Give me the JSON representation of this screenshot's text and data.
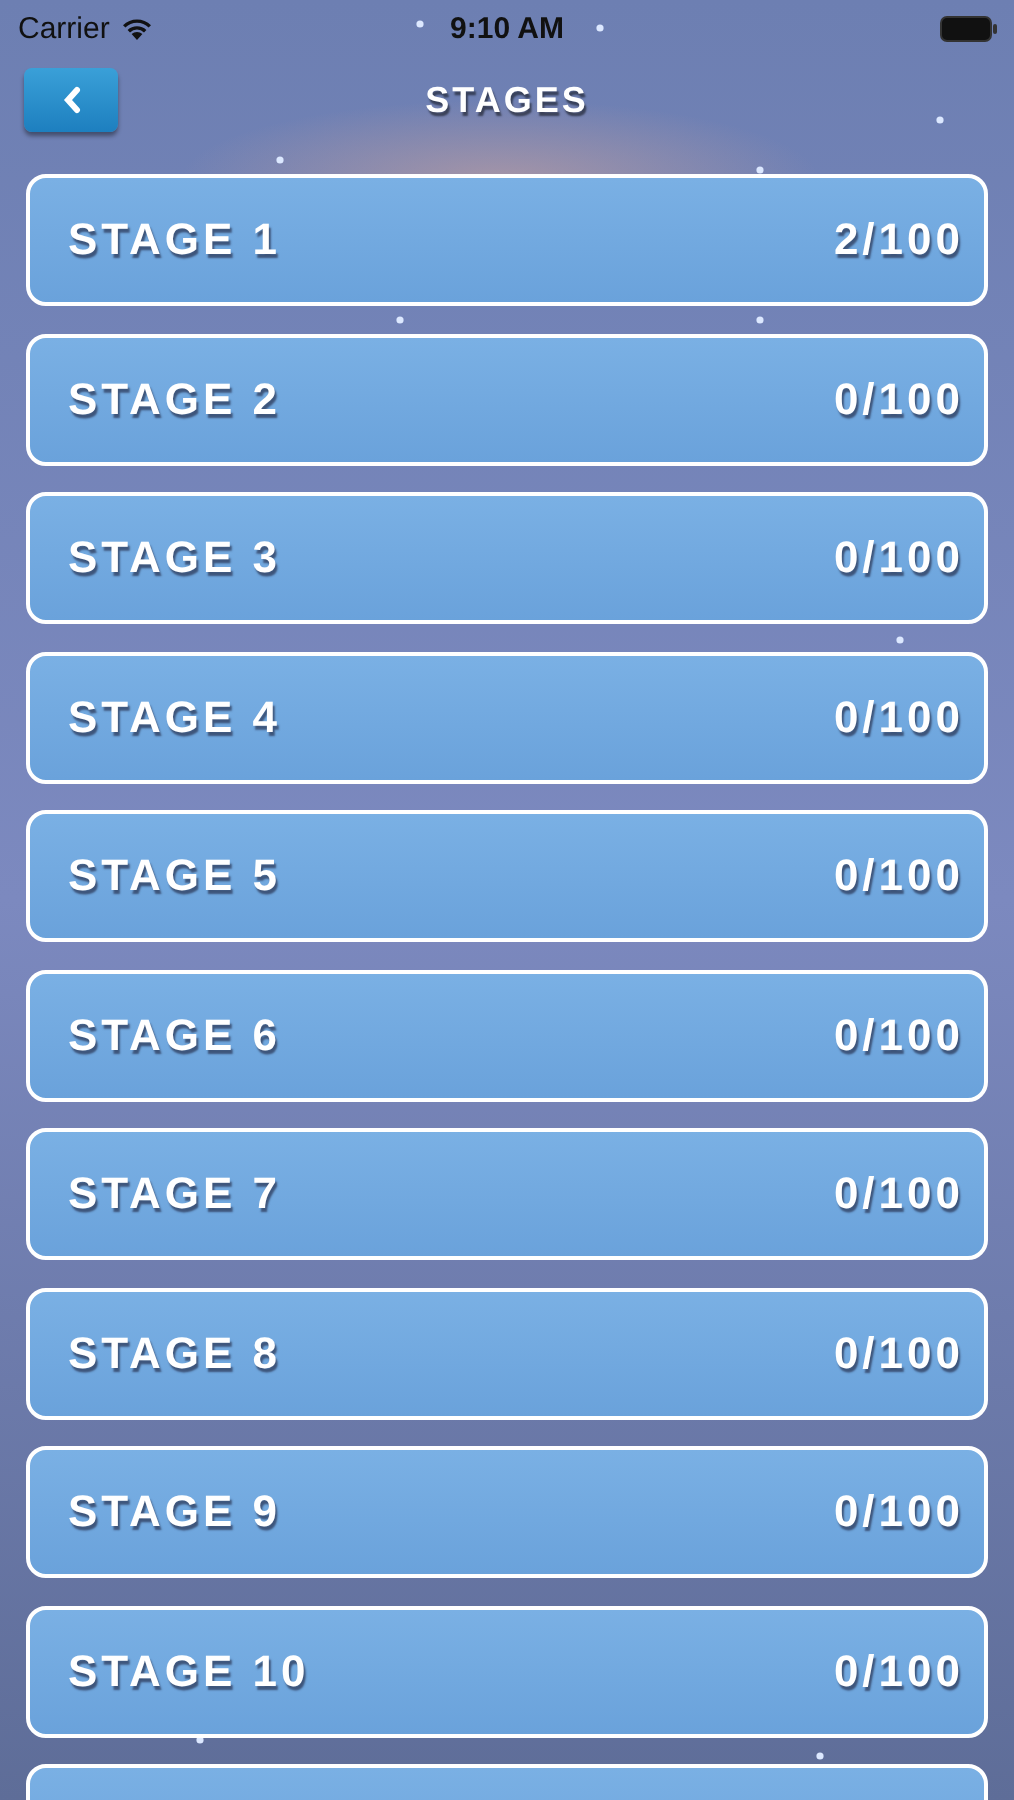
{
  "status_bar": {
    "carrier": "Carrier",
    "time": "9:10 AM"
  },
  "header": {
    "title": "STAGES"
  },
  "stages": [
    {
      "name": "STAGE 1",
      "score": "2/100"
    },
    {
      "name": "STAGE 2",
      "score": "0/100"
    },
    {
      "name": "STAGE 3",
      "score": "0/100"
    },
    {
      "name": "STAGE 4",
      "score": "0/100"
    },
    {
      "name": "STAGE 5",
      "score": "0/100"
    },
    {
      "name": "STAGE 6",
      "score": "0/100"
    },
    {
      "name": "STAGE 7",
      "score": "0/100"
    },
    {
      "name": "STAGE 8",
      "score": "0/100"
    },
    {
      "name": "STAGE 9",
      "score": "0/100"
    },
    {
      "name": "STAGE 10",
      "score": "0/100"
    }
  ]
}
